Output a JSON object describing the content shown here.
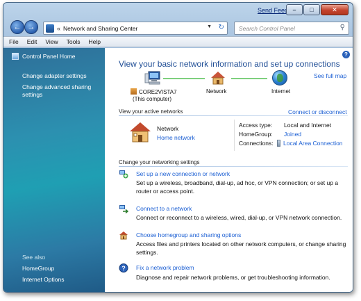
{
  "titlebar": {
    "send_feedback": "Send Feedback",
    "minimize": "–",
    "maximize": "□",
    "close": "✕"
  },
  "address": {
    "chevron": "«",
    "path": "Network and Sharing Center",
    "search_placeholder": "Search Control Panel"
  },
  "menu": [
    "File",
    "Edit",
    "View",
    "Tools",
    "Help"
  ],
  "sidebar": {
    "home": "Control Panel Home",
    "links": [
      "Change adapter settings",
      "Change advanced sharing",
      "settings"
    ],
    "see_also": "See also",
    "see_also_links": [
      "HomeGroup",
      "Internet Options"
    ]
  },
  "main": {
    "title": "View your basic network information and set up connections",
    "see_full_map": "See full map",
    "map": {
      "computer_name": "CORE2VISTA7",
      "computer_note": "(This computer)",
      "network": "Network",
      "internet": "Internet"
    },
    "active_heading": "View your active networks",
    "connect_disconnect": "Connect or disconnect",
    "active_network": {
      "name": "Network",
      "type": "Home network"
    },
    "details": [
      {
        "key": "Access type:",
        "value": "Local and Internet",
        "link": false
      },
      {
        "key": "HomeGroup:",
        "value": "Joined",
        "link": true
      },
      {
        "key": "Connections:",
        "value": "Local Area Connection",
        "link": true
      }
    ],
    "change_heading": "Change your networking settings",
    "tasks": [
      {
        "title": "Set up a new connection or network",
        "desc": "Set up a wireless, broadband, dial-up, ad hoc, or VPN connection; or set up a router or access point.",
        "icon": "network-setup-icon"
      },
      {
        "title": "Connect to a network",
        "desc": "Connect or reconnect to a wireless, wired, dial-up, or VPN network connection.",
        "icon": "connect-network-icon"
      },
      {
        "title": "Choose homegroup and sharing options",
        "desc": "Access files and printers located on other network computers, or change sharing settings.",
        "icon": "homegroup-icon"
      },
      {
        "title": "Fix a network problem",
        "desc": "Diagnose and repair network problems, or get troubleshooting information.",
        "icon": "troubleshoot-icon"
      }
    ]
  },
  "colors": {
    "link": "#1a5ed3",
    "title": "#1f4d95",
    "sidebar_top": "#2f6f99",
    "sidebar_mid": "#1f9fb3"
  }
}
